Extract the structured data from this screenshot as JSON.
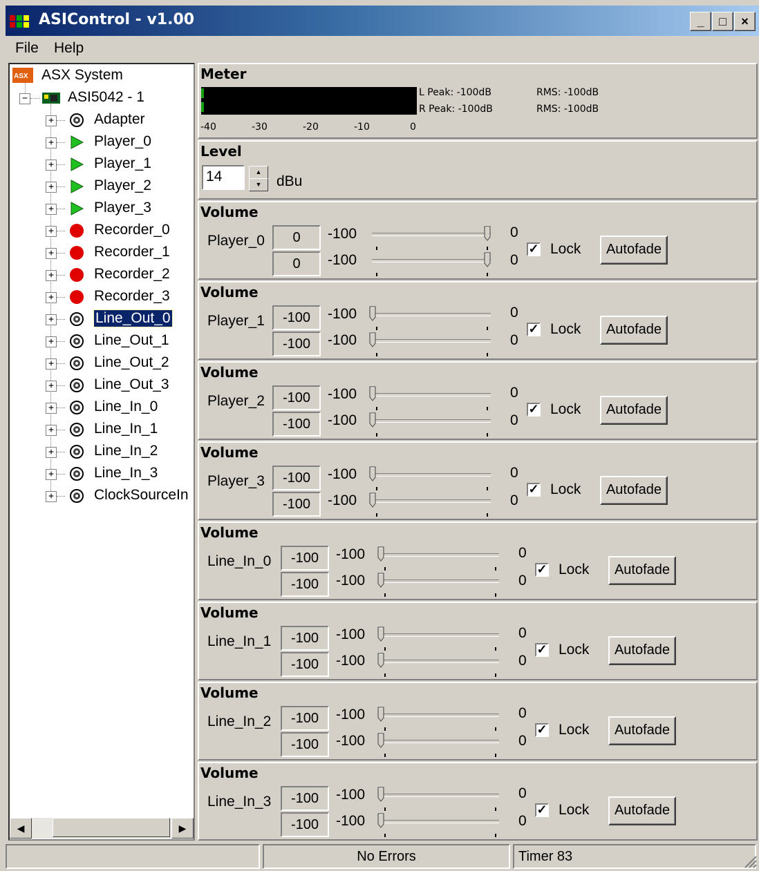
{
  "window": {
    "title": "ASIControl - v1.00"
  },
  "menu": {
    "file": "File",
    "help": "Help"
  },
  "tree": {
    "root": "ASX System",
    "adapter": "ASI5042 - 1",
    "nodes": [
      {
        "label": "Adapter",
        "icon": "speaker-icon"
      },
      {
        "label": "Player_0",
        "icon": "play-icon"
      },
      {
        "label": "Player_1",
        "icon": "play-icon"
      },
      {
        "label": "Player_2",
        "icon": "play-icon"
      },
      {
        "label": "Player_3",
        "icon": "play-icon"
      },
      {
        "label": "Recorder_0",
        "icon": "record-icon"
      },
      {
        "label": "Recorder_1",
        "icon": "record-icon"
      },
      {
        "label": "Recorder_2",
        "icon": "record-icon"
      },
      {
        "label": "Recorder_3",
        "icon": "record-icon"
      },
      {
        "label": "Line_Out_0",
        "icon": "speaker-icon",
        "selected": true
      },
      {
        "label": "Line_Out_1",
        "icon": "speaker-icon"
      },
      {
        "label": "Line_Out_2",
        "icon": "speaker-icon"
      },
      {
        "label": "Line_Out_3",
        "icon": "speaker-icon"
      },
      {
        "label": "Line_In_0",
        "icon": "speaker-icon"
      },
      {
        "label": "Line_In_1",
        "icon": "speaker-icon"
      },
      {
        "label": "Line_In_2",
        "icon": "speaker-icon"
      },
      {
        "label": "Line_In_3",
        "icon": "speaker-icon"
      },
      {
        "label": "ClockSourceIn",
        "icon": "speaker-icon"
      }
    ]
  },
  "meter": {
    "title": "Meter",
    "l_peak": "L Peak: -100dB",
    "r_peak": "R Peak: -100dB",
    "l_rms": "RMS: -100dB",
    "r_rms": "RMS: -100dB",
    "scale": [
      "-40",
      "-30",
      "-20",
      "-10",
      "0"
    ]
  },
  "level": {
    "title": "Level",
    "value": "14",
    "unit": "dBu"
  },
  "volumes": [
    {
      "title": "Volume",
      "name": "Player_0",
      "v1": "0",
      "v2": "0",
      "min": "-100",
      "max": "0",
      "lock": "Lock",
      "autofade": "Autofade",
      "level": 1.0
    },
    {
      "title": "Volume",
      "name": "Player_1",
      "v1": "-100",
      "v2": "-100",
      "min": "-100",
      "max": "0",
      "lock": "Lock",
      "autofade": "Autofade",
      "level": 0.0
    },
    {
      "title": "Volume",
      "name": "Player_2",
      "v1": "-100",
      "v2": "-100",
      "min": "-100",
      "max": "0",
      "lock": "Lock",
      "autofade": "Autofade",
      "level": 0.0
    },
    {
      "title": "Volume",
      "name": "Player_3",
      "v1": "-100",
      "v2": "-100",
      "min": "-100",
      "max": "0",
      "lock": "Lock",
      "autofade": "Autofade",
      "level": 0.0
    },
    {
      "title": "Volume",
      "name": "Line_In_0",
      "v1": "-100",
      "v2": "-100",
      "min": "-100",
      "max": "0",
      "lock": "Lock",
      "autofade": "Autofade",
      "level": 0.0
    },
    {
      "title": "Volume",
      "name": "Line_In_1",
      "v1": "-100",
      "v2": "-100",
      "min": "-100",
      "max": "0",
      "lock": "Lock",
      "autofade": "Autofade",
      "level": 0.0
    },
    {
      "title": "Volume",
      "name": "Line_In_2",
      "v1": "-100",
      "v2": "-100",
      "min": "-100",
      "max": "0",
      "lock": "Lock",
      "autofade": "Autofade",
      "level": 0.0
    },
    {
      "title": "Volume",
      "name": "Line_In_3",
      "v1": "-100",
      "v2": "-100",
      "min": "-100",
      "max": "0",
      "lock": "Lock",
      "autofade": "Autofade",
      "level": 0.0
    }
  ],
  "status": {
    "left": "",
    "middle": "No Errors",
    "right": "Timer 83"
  },
  "colors": {
    "titlebar": "#0a246a",
    "face": "#d4d0c8",
    "play": "#20c020",
    "record": "#e00000"
  }
}
